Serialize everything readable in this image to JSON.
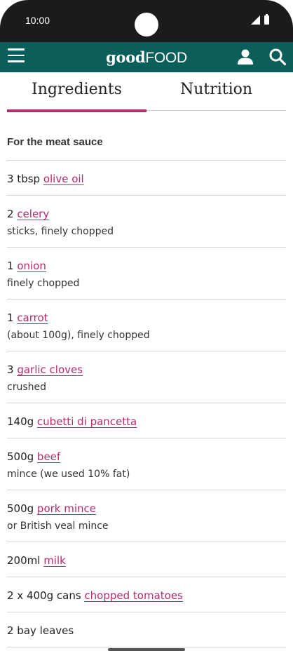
{
  "status_bar": {
    "time": "10:00"
  },
  "header": {
    "logo_part1": "good",
    "logo_part2": "FOOD"
  },
  "tabs": [
    {
      "label": "Ingredients",
      "active": true
    },
    {
      "label": "Nutrition",
      "active": false
    }
  ],
  "section": {
    "heading": "For the meat sauce"
  },
  "ingredients": [
    {
      "qty": "3 tbsp ",
      "item": "olive oil",
      "note": ""
    },
    {
      "qty": "2 ",
      "item": "celery",
      "note": "sticks, finely chopped"
    },
    {
      "qty": "1 ",
      "item": "onion",
      "note": "finely chopped"
    },
    {
      "qty": "1 ",
      "item": "carrot",
      "note": "(about 100g), finely chopped"
    },
    {
      "qty": "3 ",
      "item": "garlic cloves",
      "note": "crushed"
    },
    {
      "qty": "140g ",
      "item": "cubetti di pancetta",
      "note": ""
    },
    {
      "qty": "500g ",
      "item": "beef",
      "note": "mince (we used 10% fat)"
    },
    {
      "qty": "500g ",
      "item": "pork mince",
      "note": "or British veal mince"
    },
    {
      "qty": "200ml ",
      "item": "milk",
      "note": ""
    },
    {
      "qty": "2 x 400g cans ",
      "item": "chopped tomatoes",
      "note": ""
    },
    {
      "qty": "2 bay leaves",
      "item": "",
      "note": ""
    }
  ],
  "colors": {
    "header": "#0b5e5a",
    "accent": "#b8296e"
  },
  "icons": [
    "menu-icon",
    "user-icon",
    "search-icon"
  ]
}
